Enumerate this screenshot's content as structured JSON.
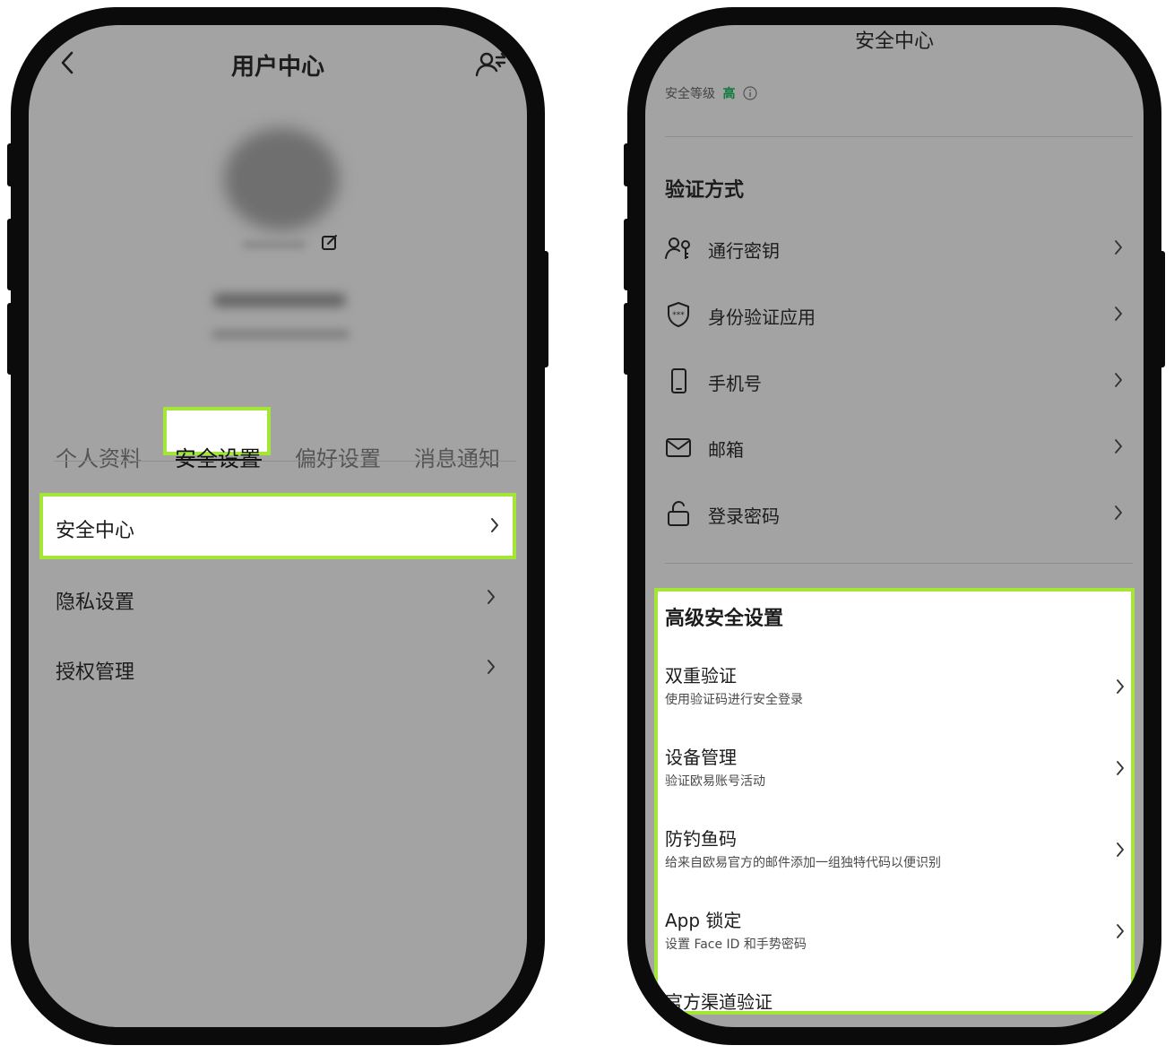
{
  "left_screen": {
    "header": {
      "title": "用户中心",
      "back_icon": "chevron-left-icon",
      "action_icon": "user-switch-icon"
    },
    "profile": {
      "avatar_icon": "avatar",
      "edit_icon": "edit-icon"
    },
    "tabs": [
      {
        "label": "个人资料",
        "active": false
      },
      {
        "label": "安全设置",
        "active": true
      },
      {
        "label": "偏好设置",
        "active": false
      },
      {
        "label": "消息通知",
        "active": false
      }
    ],
    "menu": [
      {
        "label": "安全中心",
        "highlighted": true
      },
      {
        "label": "隐私设置",
        "highlighted": false
      },
      {
        "label": "授权管理",
        "highlighted": false
      }
    ]
  },
  "right_screen": {
    "header": {
      "title": "安全中心",
      "back_icon": "chevron-left-icon"
    },
    "security_level": {
      "label": "安全等级",
      "value": "高",
      "value_color": "#0f7a3a",
      "info_icon": "info-icon"
    },
    "verification": {
      "title": "验证方式",
      "items": [
        {
          "label": "通行密钥",
          "icon": "passkey-icon"
        },
        {
          "label": "身份验证应用",
          "icon": "shield-icon"
        },
        {
          "label": "手机号",
          "icon": "phone-icon"
        },
        {
          "label": "邮箱",
          "icon": "mail-icon"
        },
        {
          "label": "登录密码",
          "icon": "lock-icon"
        }
      ]
    },
    "advanced": {
      "title": "高级安全设置",
      "items": [
        {
          "label": "双重验证",
          "desc": "使用验证码进行安全登录"
        },
        {
          "label": "设备管理",
          "desc": "验证欧易账号活动"
        },
        {
          "label": "防钓鱼码",
          "desc": "给来自欧易官方的邮件添加一组独特代码以便识别"
        },
        {
          "label": "App 锁定",
          "desc": "设置 Face ID 和手势密码"
        },
        {
          "label": "官方渠道验证",
          "desc": ""
        }
      ]
    }
  },
  "colors": {
    "highlight": "#a3e635",
    "screen_bg": "#a3a3a3",
    "frame": "#0b0b0b"
  }
}
